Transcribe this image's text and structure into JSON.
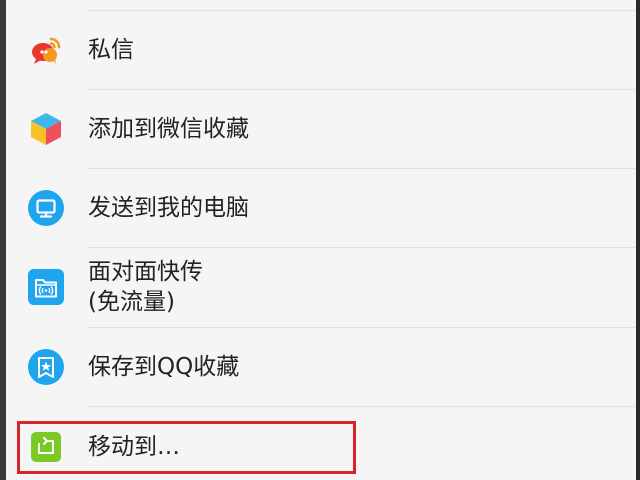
{
  "menu": {
    "items": [
      {
        "id": "private-message",
        "label": "私信"
      },
      {
        "id": "add-to-wechat-favorites",
        "label": "添加到微信收藏"
      },
      {
        "id": "send-to-my-computer",
        "label": "发送到我的电脑"
      },
      {
        "id": "face-to-face-transfer",
        "label_line1": "面对面快传",
        "label_line2": "(免流量)"
      },
      {
        "id": "save-to-qq-favorites",
        "label": "保存到QQ收藏"
      },
      {
        "id": "move-to",
        "label": "移动到…"
      }
    ]
  },
  "icons": {
    "private_message": "chat-bubbles-icon",
    "wechat_favorites": "cube-icon",
    "my_computer": "monitor-icon",
    "face_to_face": "wireless-folder-icon",
    "qq_favorites": "star-bookmark-icon",
    "move_to": "move-folder-icon"
  },
  "colors": {
    "background": "#f5f5f5",
    "text": "#222222",
    "divider": "#e2e2e2",
    "highlight": "#d9242b",
    "blue_icon": "#1ea5ed",
    "green_icon": "#7cc825",
    "chat_red": "#e8372f",
    "chat_orange": "#f39a1e"
  }
}
